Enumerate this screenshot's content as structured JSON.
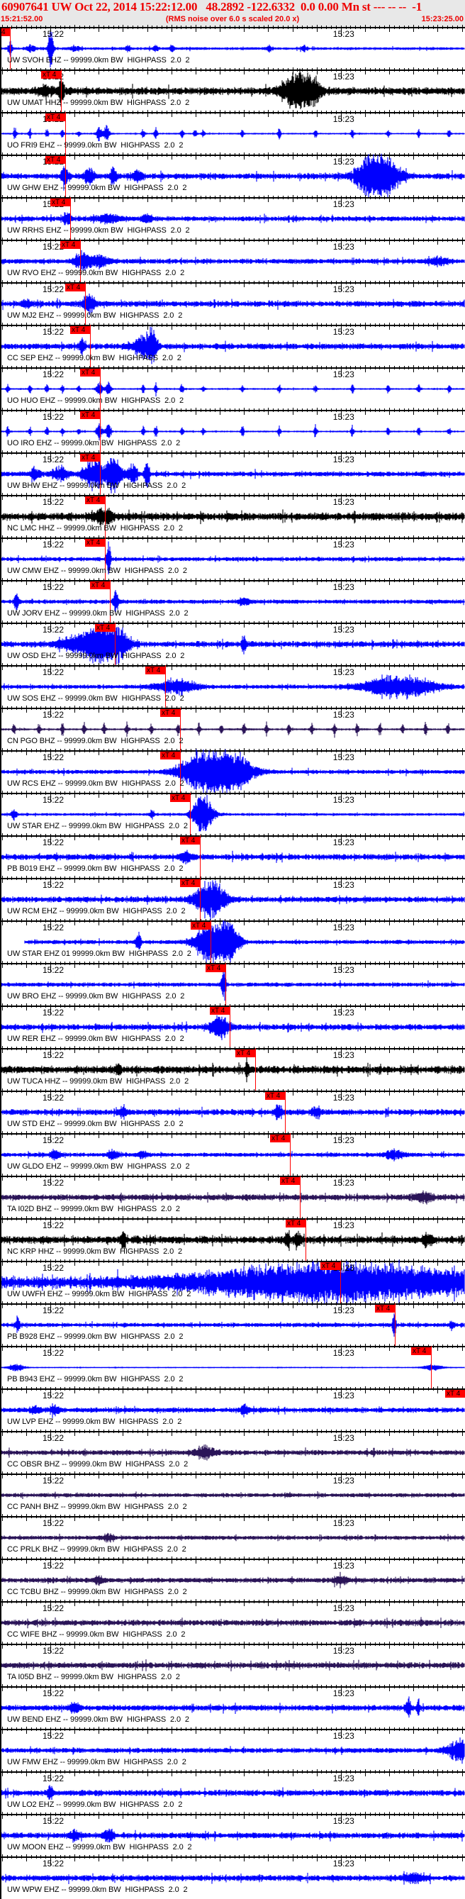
{
  "header": {
    "title": "60907641 UW Oct 22, 2014 15:22:12.00   48.2892 -122.6332  0.0 0.00 Mn st --- -- --  -1",
    "start_time": "15:21:52.00",
    "rms_note": "(RMS noise over 6.0 s scaled 20.0 x)",
    "end_time": "15:23:25.00"
  },
  "axis": {
    "tick_label_1": "15:22",
    "tick_label_2": "15:23"
  },
  "colors": {
    "blue": "#0000ff",
    "black": "#000000",
    "purple": "#2a1458",
    "pick": "#ff0000"
  },
  "traces": [
    {
      "label": "UW SVOH EHZ -- 99999.0km BW  HIGHPASS  2.0  2",
      "color": "blue",
      "pick": -8.3,
      "pick_label": "4",
      "noise": 1.2,
      "bursts": [
        [
          -8.3,
          12,
          0.4
        ],
        [
          0.1,
          30,
          0.5
        ],
        [
          -4,
          4,
          1
        ],
        [
          5,
          3,
          1
        ],
        [
          16,
          4,
          0.6
        ],
        [
          21.8,
          4,
          0.6
        ],
        [
          25.2,
          5,
          0.5
        ],
        [
          45.2,
          4,
          0.5
        ],
        [
          52.3,
          4,
          0.5
        ]
      ]
    },
    {
      "label": "UW UMAT HHZ -- 99999.0km BW  HIGHPASS  2.0  2",
      "color": "black",
      "pick": 2.2,
      "pick_label": "xT 4",
      "noise": 4,
      "bursts": [
        [
          2.2,
          14,
          0.6
        ],
        [
          -1,
          6,
          1.5
        ],
        [
          51,
          22,
          3
        ],
        [
          54,
          14,
          2
        ]
      ]
    },
    {
      "label": "UO FRI9 EHZ -- 99999.0km BW  HIGHPASS  2.0  2",
      "color": "blue",
      "pick": 3.1,
      "pick_label": "xT 4",
      "noise": 0.6,
      "bursts": [
        [
          -7.3,
          9,
          0.3
        ],
        [
          -4.2,
          7,
          0.3
        ],
        [
          -0.7,
          6,
          0.3
        ],
        [
          2.5,
          6,
          0.3
        ],
        [
          5.9,
          4,
          0.3
        ],
        [
          10.1,
          10,
          0.6
        ],
        [
          11.6,
          10,
          0.6
        ],
        [
          19.2,
          8,
          0.3
        ],
        [
          21.8,
          10,
          0.3
        ],
        [
          27.2,
          8,
          0.3
        ],
        [
          29.9,
          6,
          0.3
        ],
        [
          31.6,
          5,
          0.3
        ],
        [
          39.7,
          7,
          0.3
        ],
        [
          47.3,
          8,
          0.3
        ],
        [
          54.8,
          6,
          0.3
        ],
        [
          62.4,
          8,
          0.3
        ],
        [
          69.8,
          6,
          0.3
        ],
        [
          76.1,
          7,
          0.3
        ],
        [
          82.4,
          6,
          0.3
        ]
      ]
    },
    {
      "label": "UW GHW EHZ -- 99999.0km BW  HIGHPASS  2.0  2",
      "color": "blue",
      "pick": 3.1,
      "pick_label": "xT 4",
      "noise": 3,
      "bursts": [
        [
          3,
          12,
          0.8
        ],
        [
          8,
          10,
          1
        ],
        [
          13,
          9,
          0.8
        ],
        [
          18,
          7,
          1
        ],
        [
          66,
          28,
          3
        ],
        [
          70,
          22,
          2.5
        ]
      ]
    },
    {
      "label": "UW RRHS EHZ -- 99999.0km BW  HIGHPASS  2.0  2",
      "color": "blue",
      "pick": 4.1,
      "pick_label": "xT 4",
      "noise": 2.5,
      "bursts": [
        [
          3.5,
          10,
          0.8
        ],
        [
          12,
          5,
          3
        ],
        [
          20,
          6,
          1
        ]
      ]
    },
    {
      "label": "UW RVO EHZ -- 99999.0km BW  HIGHPASS  2.0  2",
      "color": "blue",
      "pick": 6.1,
      "pick_label": "xT 4",
      "noise": 2.5,
      "bursts": [
        [
          6.5,
          12,
          1.5
        ],
        [
          10,
          8,
          2
        ],
        [
          80,
          5,
          2
        ]
      ]
    },
    {
      "label": "UW MJ2 EHZ -- 99999.0km BW  HIGHPASS  2.0  2",
      "color": "blue",
      "pick": 7.2,
      "pick_label": "xT 4",
      "noise": 3,
      "bursts": [
        [
          8,
          12,
          1.2
        ],
        [
          -5,
          5,
          1
        ]
      ]
    },
    {
      "label": "CC SEP EHZ -- 99999.0km BW  HIGHPASS  2.0  2",
      "color": "blue",
      "pick": 8.2,
      "pick_label": "xT 4",
      "noise": 3,
      "bursts": [
        [
          6.5,
          12,
          0.5
        ],
        [
          19,
          14,
          2
        ],
        [
          21,
          22,
          1
        ]
      ]
    },
    {
      "label": "UO HUO EHZ -- 99999.0km BW  HIGHPASS  2.0  2",
      "color": "blue",
      "pick": 10.2,
      "pick_label": "xT 4",
      "noise": 0.6,
      "bursts": [
        [
          -8.8,
          7,
          0.3
        ],
        [
          -4.2,
          7,
          0.3
        ],
        [
          -0.7,
          6,
          0.3
        ],
        [
          2.5,
          6,
          0.3
        ],
        [
          5.9,
          4,
          0.3
        ],
        [
          10.1,
          10,
          0.6
        ],
        [
          12,
          8,
          0.6
        ],
        [
          19.2,
          7,
          0.3
        ],
        [
          21.8,
          9,
          0.3
        ],
        [
          27.2,
          8,
          0.3
        ],
        [
          31.6,
          5,
          0.3
        ],
        [
          39.7,
          7,
          0.3
        ],
        [
          47.3,
          8,
          0.3
        ],
        [
          54.8,
          6,
          0.3
        ],
        [
          62.4,
          8,
          0.3
        ],
        [
          69.8,
          6,
          0.3
        ],
        [
          76.1,
          7,
          0.3
        ],
        [
          82.4,
          6,
          0.3
        ]
      ]
    },
    {
      "label": "UO IRO EHZ -- 99999.0km BW  HIGHPASS  2.0  2",
      "color": "blue",
      "pick": 10.2,
      "pick_label": "xT 4",
      "noise": 0.6,
      "bursts": [
        [
          -8.8,
          7,
          0.3
        ],
        [
          -4.2,
          6,
          0.3
        ],
        [
          -0.7,
          7,
          0.3
        ],
        [
          2.5,
          6,
          0.3
        ],
        [
          5.9,
          4,
          0.3
        ],
        [
          10.1,
          12,
          0.6
        ],
        [
          12,
          10,
          0.6
        ],
        [
          19.2,
          7,
          0.3
        ],
        [
          21.8,
          9,
          0.3
        ],
        [
          27.2,
          7,
          0.3
        ],
        [
          31.6,
          5,
          0.3
        ],
        [
          39.7,
          10,
          0.3
        ],
        [
          47.3,
          8,
          0.3
        ],
        [
          54.8,
          10,
          0.3
        ],
        [
          62.4,
          8,
          0.3
        ],
        [
          69.8,
          6,
          0.3
        ],
        [
          76.1,
          7,
          0.3
        ],
        [
          82.4,
          6,
          0.3
        ]
      ]
    },
    {
      "label": "UW BHW EHZ -- 99999.0km BW  HIGHPASS  2.0  2",
      "color": "blue",
      "pick": 10.2,
      "pick_label": "xT 4",
      "noise": 2.5,
      "bursts": [
        [
          -3,
          8,
          1
        ],
        [
          2,
          10,
          1.5
        ],
        [
          9,
          22,
          2
        ],
        [
          13,
          26,
          1.5
        ],
        [
          17,
          15,
          1
        ],
        [
          20,
          20,
          0.5
        ]
      ]
    },
    {
      "label": "NC LMC HHZ -- 99999.0km BW  HIGHPASS  2.0  2",
      "color": "black",
      "pick": 11.3,
      "pick_label": "xT 4",
      "noise": 4,
      "bursts": [
        [
          11,
          10,
          2
        ]
      ]
    },
    {
      "label": "UW CMW EHZ -- 99999.0km BW  HIGHPASS  2.0  2",
      "color": "blue",
      "pick": 11.3,
      "pick_label": "xT 4",
      "noise": 2,
      "bursts": [
        [
          12,
          26,
          0.4
        ]
      ]
    },
    {
      "label": "UW JORV EHZ -- 99999.0km BW  HIGHPASS  2.0  2",
      "color": "blue",
      "pick": 12.3,
      "pick_label": "xT 4",
      "noise": 2,
      "bursts": [
        [
          -7,
          10,
          0.5
        ],
        [
          13.5,
          18,
          0.5
        ],
        [
          40,
          6,
          1
        ]
      ]
    },
    {
      "label": "UW OSD EHZ -- 99999.0km BW  HIGHPASS  2.0  2",
      "color": "blue",
      "pick": 13.3,
      "pick_label": "xT 4",
      "noise": 3,
      "bursts": [
        [
          5,
          10,
          3
        ],
        [
          10,
          26,
          3
        ],
        [
          14,
          22,
          2
        ],
        [
          40,
          14,
          0.4
        ]
      ]
    },
    {
      "label": "UW SOS EHZ -- 99999.0km BW  HIGHPASS  2.0  2",
      "color": "blue",
      "pick": 23.7,
      "pick_label": "xT 4",
      "noise": 2,
      "bursts": [
        [
          26,
          10,
          4
        ],
        [
          72,
          16,
          7
        ]
      ]
    },
    {
      "label": "CN PGO BHZ -- 99999.0km BW  HIGHPASS  2.0  2",
      "color": "purple",
      "pick": 26.8,
      "pick_label": "xT 4",
      "noise": 0.8,
      "bursts": [
        [
          -7.5,
          9,
          0.3
        ],
        [
          -2.3,
          9,
          0.3
        ],
        [
          2.5,
          9,
          0.3
        ],
        [
          7,
          9,
          0.3
        ],
        [
          11.1,
          9,
          0.3
        ],
        [
          15.8,
          9,
          0.3
        ],
        [
          20.9,
          9,
          0.3
        ],
        [
          26.4,
          9,
          0.3
        ],
        [
          30.7,
          9,
          0.3
        ],
        [
          35.3,
          9,
          0.3
        ],
        [
          40,
          9,
          0.3
        ],
        [
          44.7,
          9,
          0.3
        ],
        [
          49.3,
          9,
          0.3
        ],
        [
          54,
          9,
          0.3
        ],
        [
          58.7,
          9,
          0.3
        ],
        [
          63.4,
          9,
          0.3
        ],
        [
          68.1,
          9,
          0.3
        ],
        [
          72.8,
          9,
          0.3
        ],
        [
          77.5,
          9,
          0.3
        ],
        [
          82.1,
          9,
          0.3
        ]
      ]
    },
    {
      "label": "UW RCS EHZ -- 99999.0km BW  HIGHPASS  2.0  2",
      "color": "blue",
      "pick": 26.8,
      "pick_label": "xT 4",
      "noise": 2,
      "bursts": [
        [
          32,
          30,
          5
        ],
        [
          38,
          24,
          4
        ]
      ]
    },
    {
      "label": "UW STAR EHZ -- 99999.0km BW  HIGHPASS  2.0  2",
      "color": "blue",
      "pick": 28.8,
      "pick_label": "xT 4",
      "noise": 1.2,
      "bursts": [
        [
          -7.5,
          8,
          0.5
        ],
        [
          21,
          6,
          0.5
        ],
        [
          31.5,
          28,
          2
        ]
      ]
    },
    {
      "label": "PB B019 EHZ -- 99999.0km BW  HIGHPASS  2.0  2",
      "color": "blue",
      "pick": 30.9,
      "pick_label": "xT 4",
      "noise": 3,
      "bursts": [
        [
          28,
          8,
          1
        ]
      ]
    },
    {
      "label": "UW RCM EHZ -- 99999.0km BW  HIGHPASS  2.0  2",
      "color": "blue",
      "pick": 30.9,
      "pick_label": "xT 4",
      "noise": 3,
      "bursts": [
        [
          33,
          26,
          3
        ]
      ]
    },
    {
      "label": "UW STAR EHZ 01 99999.0km BW  HIGHPASS  2.0  2",
      "color": "blue",
      "pick": 33.1,
      "pick_label": "xT 4",
      "noise": 2,
      "start": -5.3,
      "bursts": [
        [
          18.2,
          16,
          0.5
        ],
        [
          33,
          30,
          3
        ],
        [
          37,
          26,
          2
        ]
      ]
    },
    {
      "label": "UW BRO EHZ -- 99999.0km BW  HIGHPASS  2.0  2",
      "color": "blue",
      "pick": 36.2,
      "pick_label": "xT 4",
      "noise": 2,
      "bursts": [
        [
          35.8,
          26,
          0.4
        ]
      ]
    },
    {
      "label": "UW RER EHZ -- 99999.0km BW  HIGHPASS  2.0  2",
      "color": "blue",
      "pick": 37.0,
      "pick_label": "xT 4",
      "noise": 3,
      "bursts": [
        [
          35,
          14,
          2
        ]
      ]
    },
    {
      "label": "UW TUCA HHZ -- 99999.0km BW  HIGHPASS  2.0  2",
      "color": "black",
      "pick": 42.3,
      "pick_label": "xT 4",
      "noise": 4,
      "bursts": [
        [
          14,
          8,
          0.5
        ],
        [
          40.6,
          12,
          0.4
        ]
      ]
    },
    {
      "label": "UW STD EHZ -- 99999.0km BW  HIGHPASS  2.0  2",
      "color": "blue",
      "pick": 48.5,
      "pick_label": "xT 4",
      "noise": 3,
      "bursts": [
        [
          15,
          5,
          1
        ],
        [
          47,
          8,
          0.8
        ],
        [
          55,
          6,
          1
        ]
      ]
    },
    {
      "label": "UW GLDO EHZ -- 99999.0km BW  HIGHPASS  2.0  2",
      "color": "blue",
      "pick": 49.5,
      "pick_label": "xT 4",
      "noise": 2,
      "bursts": [
        [
          1,
          6,
          1
        ],
        [
          13,
          7,
          1
        ],
        [
          19,
          5,
          1
        ],
        [
          71,
          6,
          2
        ]
      ]
    },
    {
      "label": "TA I02D BHZ -- 99999.0km BW  HIGHPASS  2.0  2",
      "color": "purple",
      "pick": 51.5,
      "pick_label": "xT 4",
      "noise": 3,
      "bursts": [
        [
          77,
          6,
          2
        ]
      ]
    },
    {
      "label": "NC KRP HHZ -- 99999.0km BW  HIGHPASS  2.0  2",
      "color": "black",
      "pick": 52.7,
      "pick_label": "xT 4",
      "noise": 4,
      "bursts": [
        [
          15,
          12,
          0.5
        ],
        [
          49,
          10,
          0.6
        ],
        [
          51,
          10,
          0.6
        ],
        [
          78,
          8,
          1
        ]
      ]
    },
    {
      "label": "UW UWFH EHZ -- 99999.0km BW  HIGHPASS  2.0  2",
      "color": "blue",
      "pick": 59.9,
      "pick_label": "xT 4",
      "noise": 6,
      "bursts": [
        [
          60,
          24,
          30
        ]
      ]
    },
    {
      "label": "PB B928 EHZ -- 99999.0km BW  HIGHPASS  2.0  2",
      "color": "blue",
      "pick": 71.2,
      "pick_label": "xT 4",
      "noise": 2,
      "bursts": [
        [
          -6.7,
          14,
          0.3
        ],
        [
          71,
          26,
          0.3
        ],
        [
          83,
          6,
          0.5
        ]
      ]
    },
    {
      "label": "PB B943 EHZ -- 99999.0km BW  HIGHPASS  2.0  2",
      "color": "blue",
      "pick": 78.6,
      "pick_label": "xT 4",
      "noise": 0.4,
      "bursts": [
        [
          -7,
          5,
          1.5
        ],
        [
          79,
          4,
          2
        ]
      ]
    },
    {
      "label": "UW LVP EHZ -- 99999.0km BW  HIGHPASS  2.0  2",
      "color": "blue",
      "pick": 85.6,
      "pick_label": "xT 4",
      "noise": 2.5,
      "bursts": [
        [
          -3,
          5,
          1
        ],
        [
          1,
          5,
          1
        ],
        [
          40,
          6,
          1
        ]
      ]
    },
    {
      "label": "CC OBSR BHZ -- 99999.0km BW  HIGHPASS  2.0  2",
      "color": "purple",
      "pick": null,
      "noise": 2.5,
      "bursts": [
        [
          32,
          8,
          2
        ]
      ]
    },
    {
      "label": "CC PANH BHZ -- 99999.0km BW  HIGHPASS  2.0  2",
      "color": "purple",
      "pick": null,
      "noise": 2,
      "bursts": []
    },
    {
      "label": "CC PRLK BHZ -- 99999.0km BW  HIGHPASS  2.0  2",
      "color": "purple",
      "pick": null,
      "noise": 2,
      "bursts": [
        [
          12,
          4,
          1
        ]
      ]
    },
    {
      "label": "CC TCBU BHZ -- 99999.0km BW  HIGHPASS  2.0  2",
      "color": "purple",
      "pick": null,
      "noise": 2.5,
      "bursts": [
        [
          10,
          5,
          1
        ],
        [
          60,
          5,
          1.5
        ]
      ]
    },
    {
      "label": "CC WIFE BHZ -- 99999.0km BW  HIGHPASS  2.0  2",
      "color": "purple",
      "pick": null,
      "noise": 3,
      "bursts": []
    },
    {
      "label": "TA I05D BHZ -- 99999.0km BW  HIGHPASS  2.0  2",
      "color": "purple",
      "pick": null,
      "noise": 3,
      "bursts": []
    },
    {
      "label": "UW BEND EHZ -- 99999.0km BW  HIGHPASS  2.0  2",
      "color": "blue",
      "pick": null,
      "noise": 3,
      "bursts": [
        [
          5,
          6,
          1
        ],
        [
          74,
          10,
          0.6
        ],
        [
          76,
          14,
          0.3
        ]
      ]
    },
    {
      "label": "UW FMW EHZ -- 99999.0km BW  HIGHPASS  2.0  2",
      "color": "blue",
      "pick": null,
      "noise": 2.5,
      "bursts": [
        [
          85,
          14,
          3
        ]
      ]
    },
    {
      "label": "UW LO2 EHZ -- 99999.0km BW  HIGHPASS  2.0  2",
      "color": "blue",
      "pick": null,
      "noise": 3,
      "bursts": [
        [
          0,
          8,
          0.6
        ]
      ]
    },
    {
      "label": "UW MOON EHZ -- 99999.0km BW  HIGHPASS  2.0  2",
      "color": "blue",
      "pick": null,
      "noise": 3,
      "bursts": [
        [
          12,
          8,
          1
        ],
        [
          5,
          6,
          1
        ]
      ]
    },
    {
      "label": "UW WPW EHZ -- 99999.0km BW  HIGHPASS  2.0  2",
      "color": "blue",
      "pick": null,
      "noise": 3,
      "bursts": [
        [
          75,
          6,
          2
        ]
      ]
    }
  ]
}
